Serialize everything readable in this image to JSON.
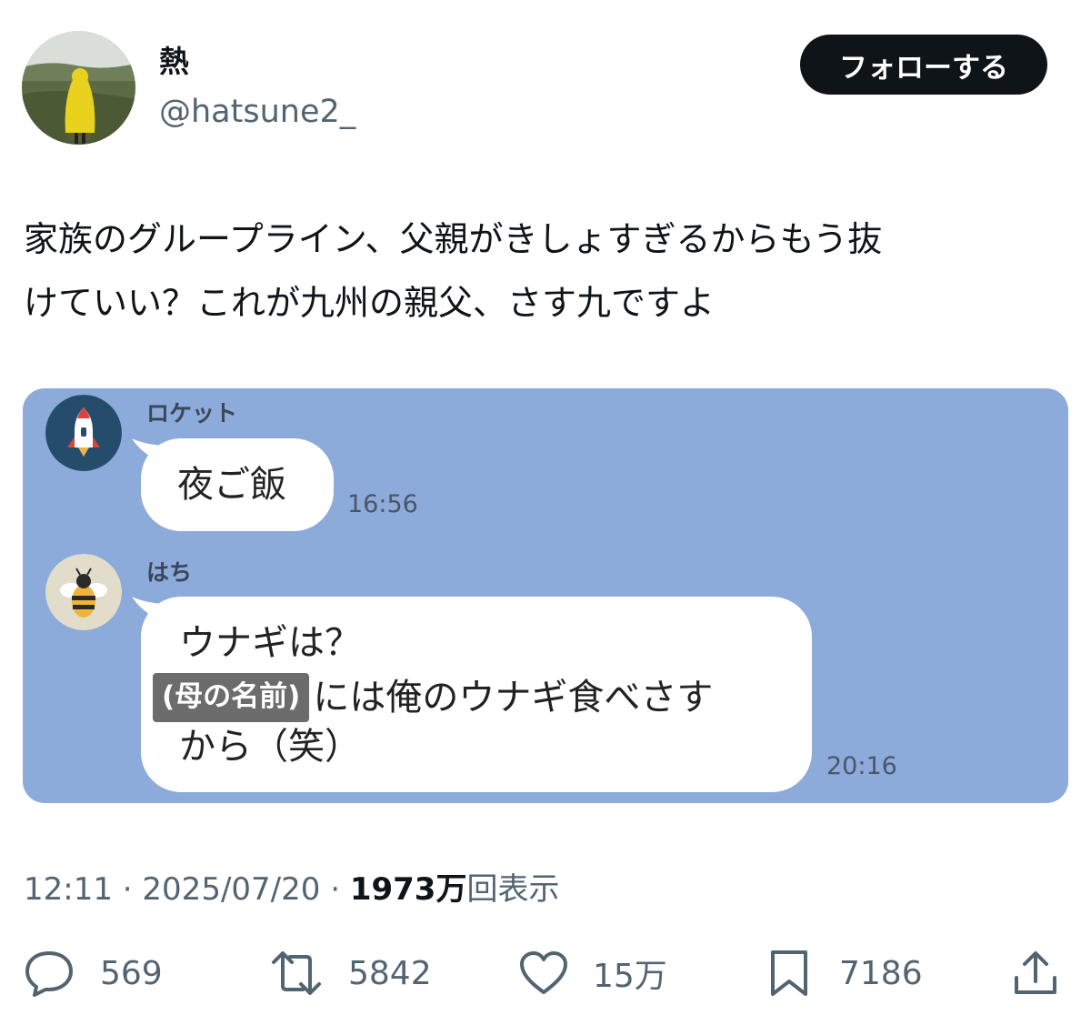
{
  "user": {
    "display_name": "熱",
    "handle": "@hatsune2_"
  },
  "follow_button": {
    "label": "フォローする"
  },
  "tweet": {
    "text_lines": [
      "家族のグループライン、父親がきしょすぎるからもう抜",
      "けていい？これが九州の親父、さす九ですよ"
    ]
  },
  "chat": {
    "messages": [
      {
        "sender": "ロケット",
        "lines": [
          "夜ご飯"
        ],
        "time": "16:56"
      },
      {
        "sender": "はち",
        "line1": "ウナギは？",
        "redacted": "(母の名前)",
        "line2_rest": "には俺のウナギ食べさす",
        "line3": "から（笑）",
        "time": "20:16"
      }
    ]
  },
  "meta": {
    "time": "12:11",
    "separator": " · ",
    "date": "2025/07/20",
    "views_count": "1973万",
    "views_label": "回表示"
  },
  "actions": {
    "replies": "569",
    "reposts": "5842",
    "likes": "15万",
    "bookmarks": "7186"
  },
  "colors": {
    "follow_bg": "#0f1419",
    "chat_bg": "#8dabda",
    "secondary_text": "#536471"
  }
}
